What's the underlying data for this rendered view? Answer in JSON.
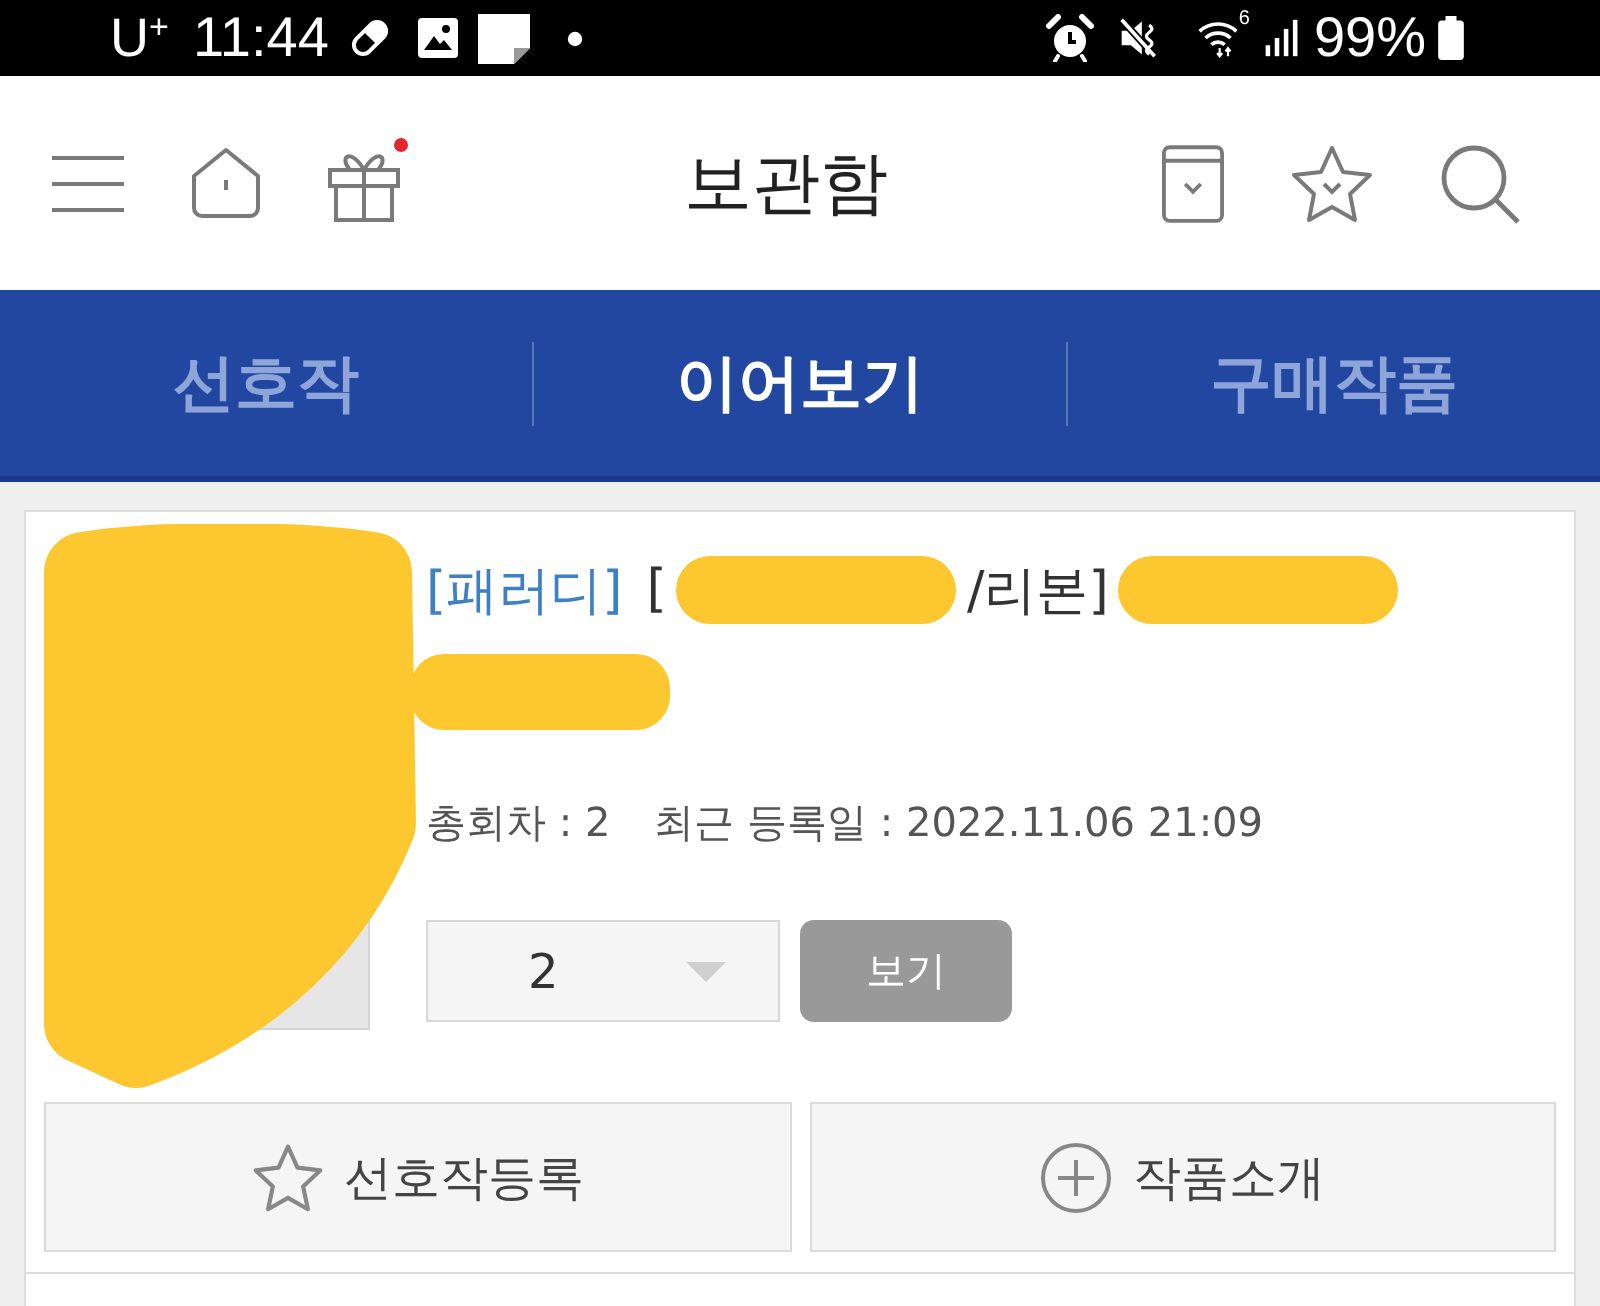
{
  "status_bar": {
    "carrier": "U$^{+}$",
    "time": "11:44",
    "wifi_label": "6",
    "battery": "99%"
  },
  "header": {
    "title": "보관함",
    "gift_badge": true
  },
  "tabs": [
    {
      "label": "선호작",
      "selected": false
    },
    {
      "label": "이어보기",
      "selected": true
    },
    {
      "label": "구매작품",
      "selected": false
    }
  ],
  "item": {
    "thumbnail": {
      "redacted": true
    },
    "title_parts": [
      {
        "kind": "tag",
        "text": "[패러디]"
      },
      {
        "kind": "text",
        "text": "["
      },
      {
        "kind": "redacted"
      },
      {
        "kind": "text",
        "text": "/리본]"
      },
      {
        "kind": "redacted"
      }
    ],
    "subtitle_parts": [
      {
        "kind": "redacted"
      }
    ],
    "meta": [
      "총회차 : 2",
      "최근 등록일 : 2022.11.06 21:09"
    ],
    "episode_select": {
      "value": "2"
    },
    "view_button": "보기",
    "actions": [
      {
        "kind": "favorite",
        "label": "선호작등록"
      },
      {
        "kind": "intro",
        "label": "작품소개"
      }
    ]
  }
}
